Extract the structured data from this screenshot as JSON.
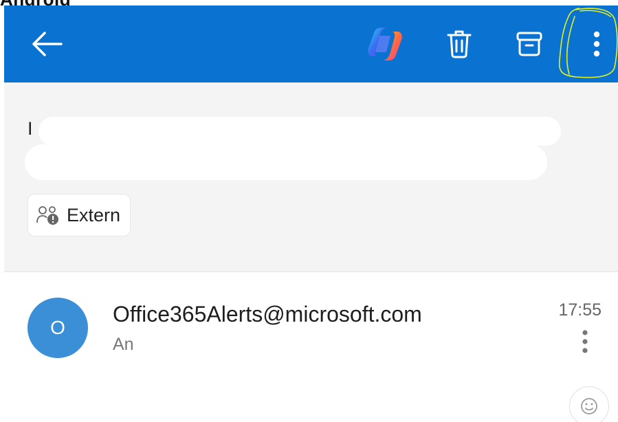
{
  "caption": "Android",
  "app_bar": {
    "background": "#0a72d1",
    "icons": {
      "back": "arrow-left-icon",
      "copilot": "copilot-icon",
      "delete": "trash-icon",
      "archive": "archive-icon",
      "more": "more-vertical-icon"
    },
    "highlight_color": "#e6f21a"
  },
  "header": {
    "subject_visible": "I",
    "external_badge": {
      "label": "Extern",
      "icon": "external-people-icon"
    }
  },
  "message": {
    "avatar_initial": "O",
    "avatar_color": "#3a8fd6",
    "sender": "Office365Alerts@microsoft.com",
    "preview": "An",
    "time": "17:55",
    "more_icon": "more-vertical-icon"
  },
  "reaction": {
    "icon": "smiley-icon"
  }
}
